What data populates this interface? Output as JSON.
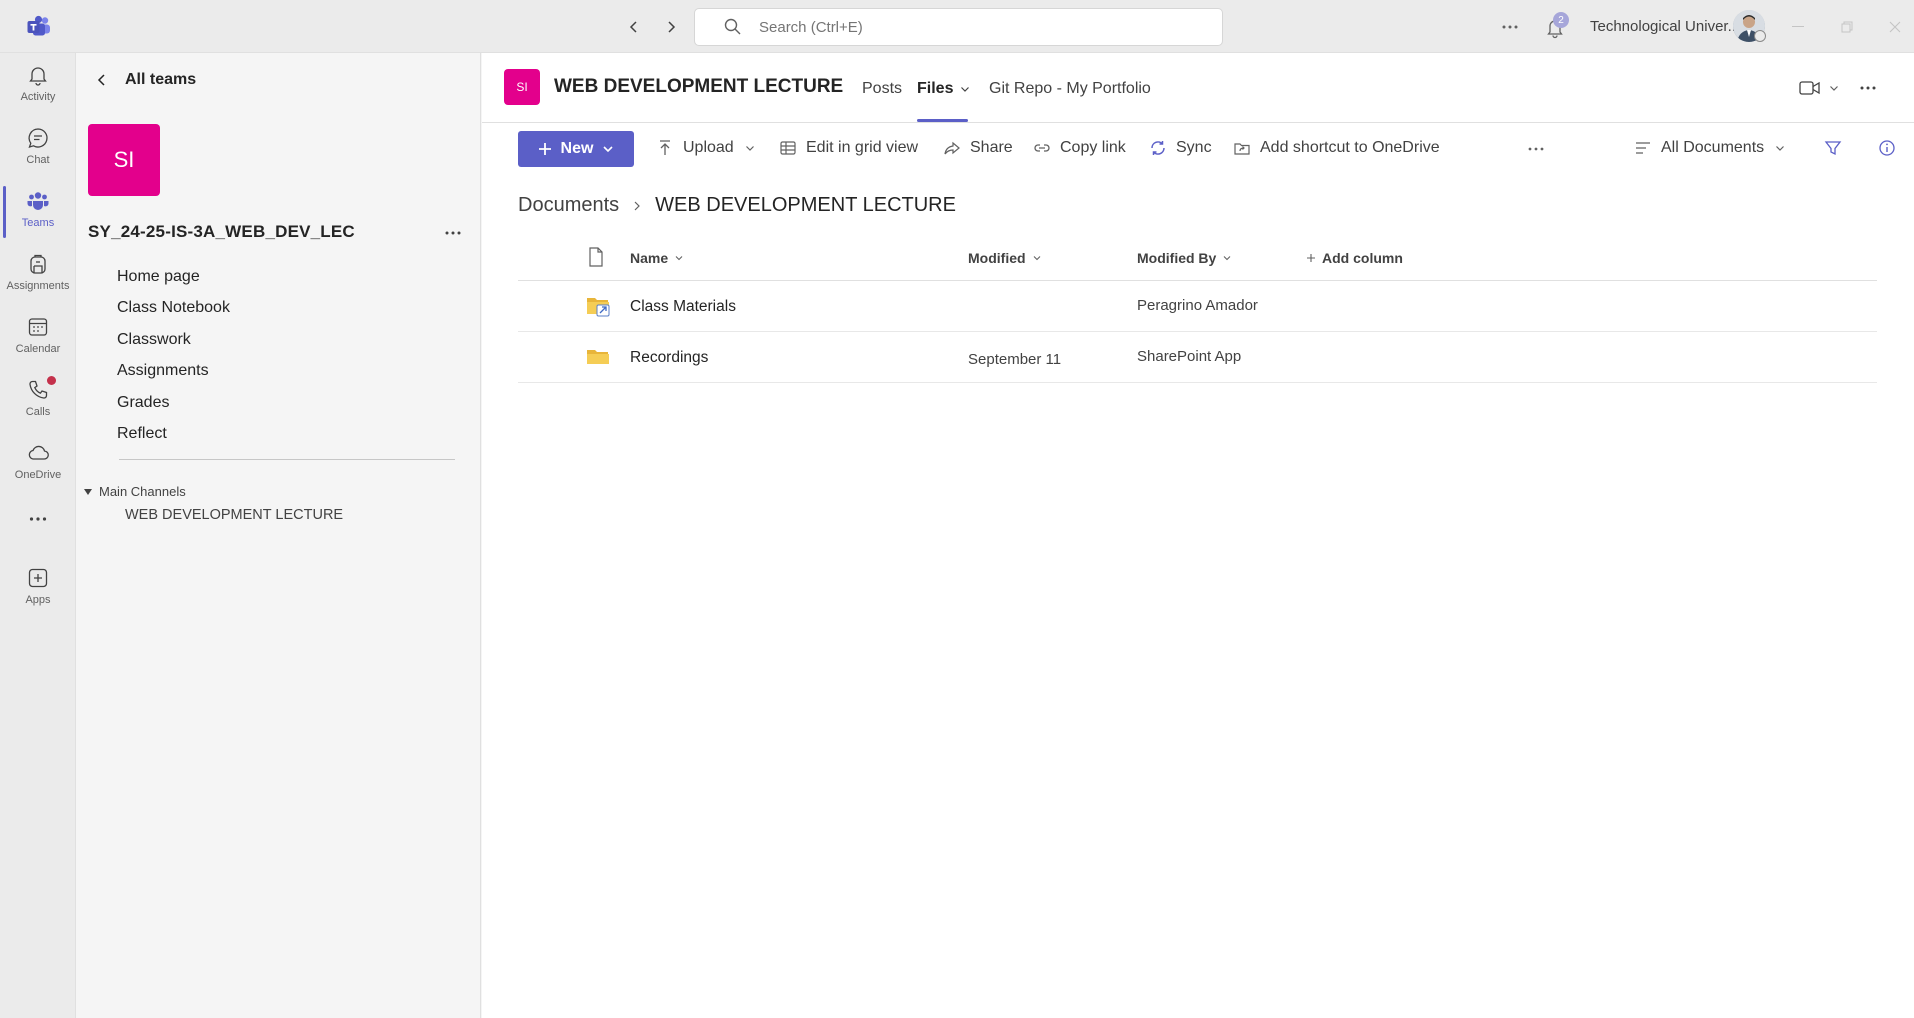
{
  "search": {
    "placeholder": "Search (Ctrl+E)"
  },
  "titlebar": {
    "notification_count": "2",
    "org_name": "Technological Univer..."
  },
  "rail": {
    "items": [
      {
        "label": "Activity",
        "icon": "bell-icon"
      },
      {
        "label": "Chat",
        "icon": "chat-icon"
      },
      {
        "label": "Teams",
        "icon": "teams-icon"
      },
      {
        "label": "Assignments",
        "icon": "backpack-icon"
      },
      {
        "label": "Calendar",
        "icon": "calendar-icon"
      },
      {
        "label": "Calls",
        "icon": "phone-icon"
      },
      {
        "label": "OneDrive",
        "icon": "cloud-icon"
      },
      {
        "label": "",
        "icon": "more-icon"
      },
      {
        "label": "Apps",
        "icon": "add-app-icon"
      }
    ],
    "active": "Teams"
  },
  "team_panel": {
    "back_label": "All teams",
    "team_initials": "SI",
    "team_name": "SY_24-25-IS-3A_WEB_DEV_LEC",
    "links": [
      "Home page",
      "Class Notebook",
      "Classwork",
      "Assignments",
      "Grades",
      "Reflect"
    ],
    "channels_header": "Main Channels",
    "channel": "WEB DEVELOPMENT LECTURE"
  },
  "channel": {
    "initials": "SI",
    "title": "WEB DEVELOPMENT LECTURE",
    "tabs": [
      "Posts",
      "Files",
      "Git Repo - My Portfolio"
    ],
    "active_tab": "Files"
  },
  "commands": {
    "new": "New",
    "upload": "Upload",
    "edit_grid": "Edit in grid view",
    "share": "Share",
    "copy_link": "Copy link",
    "sync": "Sync",
    "shortcut": "Add shortcut to OneDrive",
    "view": "All Documents"
  },
  "breadcrumb": [
    "Documents",
    "WEB DEVELOPMENT LECTURE"
  ],
  "table": {
    "columns": [
      "Name",
      "Modified",
      "Modified By",
      "Add column"
    ],
    "rows": [
      {
        "name": "Class Materials",
        "modified": "",
        "modified_by": "Peragrino Amador",
        "type": "shared-folder"
      },
      {
        "name": "Recordings",
        "modified": "September 11",
        "modified_by": "SharePoint App",
        "type": "folder"
      }
    ]
  },
  "colors": {
    "accent": "#5b5fc7",
    "team_tile": "#e3008c",
    "folder": "#f2c94c",
    "notification_dot": "#c4314b"
  }
}
